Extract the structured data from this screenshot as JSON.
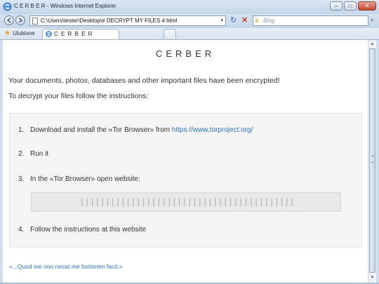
{
  "window": {
    "title": "C E R B E R - Windows Internet Explorer",
    "minimize_glyph": "–",
    "maximize_glyph": "□",
    "close_glyph": "✕"
  },
  "address_bar": {
    "url": "C:\\Users\\tester\\Desktop\\# DECRYPT MY FILES #.html",
    "dropdown_glyph": "▾",
    "refresh_glyph": "↻",
    "stop_glyph": "✕"
  },
  "search": {
    "placeholder": "Bing",
    "engine_glyph": "b",
    "go_glyph": "⌕"
  },
  "favorites": {
    "label": "Ulubione",
    "star_glyph": "★"
  },
  "tab": {
    "label": "C E R B E R"
  },
  "page": {
    "brand": "CERBER",
    "message_line1": "Your documents, photos, databases and other important files have been encrypted!",
    "message_line2": "To decrypt your files follow the instructions:",
    "steps": [
      {
        "num": "1.",
        "text": "Download and install the «Tor Browser» from ",
        "link": "https://www.torproject.org/"
      },
      {
        "num": "2.",
        "text": "Run it"
      },
      {
        "num": "3.",
        "text": "In the «Tor Browser» open website:"
      },
      {
        "num": "4.",
        "text": "Follow the instructions at this website"
      }
    ],
    "onion_address": "||||||||||||||||||||||||||||||||||||||||||||||||||||||||||||||||||||||||||||",
    "quote": "«...Quod me non necat me fortiorem facit.»"
  },
  "scrollbar": {
    "up_glyph": "▲",
    "down_glyph": "▼"
  }
}
